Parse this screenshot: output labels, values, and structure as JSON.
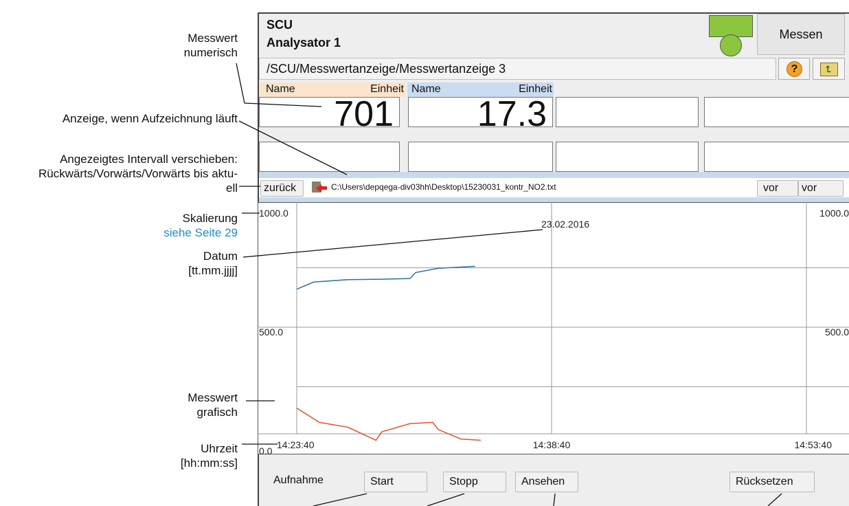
{
  "annotations": {
    "measured_numeric": [
      "Messwert",
      "numerisch"
    ],
    "recording_indicator": "Anzeige, wenn Aufzeichnung läuft",
    "shift_interval": [
      "Angezeigtes Intervall verschieben:",
      "Rückwärts/Vorwärts/Vorwärts bis aktu-",
      "ell"
    ],
    "scaling": "Skalierung",
    "scaling_link": "siehe Seite 29",
    "date": [
      "Datum",
      "[tt.mm.jjjj]"
    ],
    "measured_graphic": [
      "Messwert",
      "grafisch"
    ],
    "time": [
      "Uhrzeit",
      "[hh:mm:ss]"
    ]
  },
  "header": {
    "app": "SCU",
    "device": "Analysator 1",
    "measure_button": "Messen",
    "status_color": "#8cc63f",
    "path": "/SCU/Messwertanzeige/Messwertanzeige 3",
    "help_icon": "help-icon",
    "up_icon": "folder-up-icon"
  },
  "values": [
    {
      "name": "Name",
      "unit": "Einheit",
      "value": "701",
      "color": "#fbe3cc"
    },
    {
      "name": "Name",
      "unit": "Einheit",
      "value": "17.3",
      "color": "#c9dcf2"
    }
  ],
  "navigation": {
    "back": "zurück",
    "file": "C:\\Users\\depqega-div03hh\\Desktop\\15230031_kontr_NO2.txt",
    "forward": "vor",
    "forward_latest": "vor",
    "recording_icon": "recording-arrow-icon"
  },
  "chart_data": {
    "type": "line",
    "date": "23.02.2016",
    "ylim": [
      0,
      1000
    ],
    "y_ticks_left": [
      "1000.0",
      "500.0",
      "0.0"
    ],
    "y_ticks_right": [
      "1000.0",
      "500.0"
    ],
    "x_ticks": [
      "14:23:40",
      "14:38:40",
      "14:53:40"
    ],
    "series": [
      {
        "color": "#2e6f9e",
        "x": [
          "14:23:40",
          "14:24:40",
          "14:26:40",
          "14:28:40",
          "14:30:20",
          "14:30:40",
          "14:32:00",
          "14:34:10"
        ],
        "values": [
          660,
          690,
          700,
          702,
          705,
          730,
          748,
          756
        ]
      },
      {
        "color": "#e2542a",
        "x": [
          "14:23:40",
          "14:25:00",
          "14:26:40",
          "14:28:20",
          "14:28:40",
          "14:30:20",
          "14:31:40",
          "14:32:00",
          "14:33:20",
          "14:34:30"
        ],
        "values": [
          160,
          100,
          80,
          25,
          60,
          95,
          100,
          70,
          30,
          25
        ]
      }
    ]
  },
  "recording": {
    "label": "Aufnahme",
    "start": "Start",
    "stop": "Stopp",
    "view": "Ansehen",
    "reset": "Rücksetzen"
  }
}
